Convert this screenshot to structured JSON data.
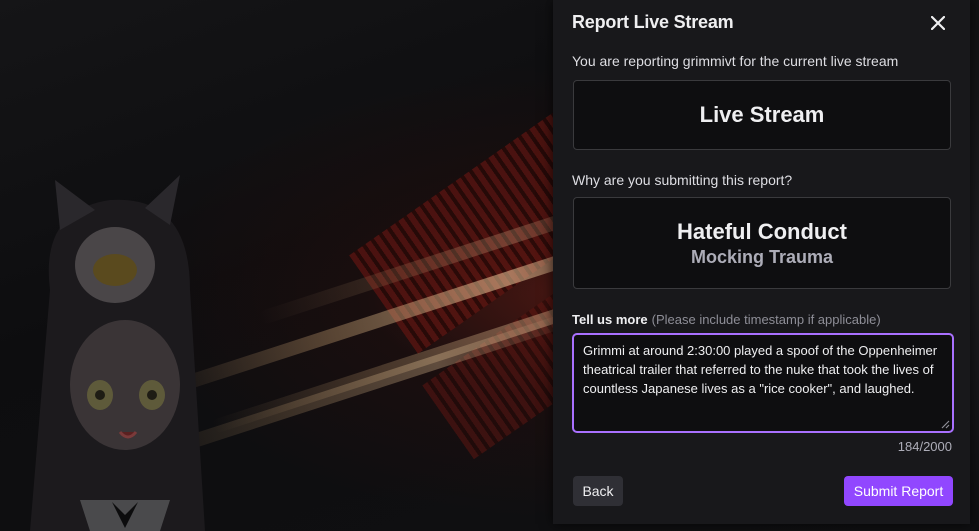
{
  "modal": {
    "title": "Report Live Stream",
    "subtitle": "You are reporting grimmivt for the current live stream",
    "content_type": "Live Stream",
    "question": "Why are you submitting this report?",
    "reason_main": "Hateful Conduct",
    "reason_sub": "Mocking Trauma",
    "tell_label": "Tell us more",
    "tell_hint": "(Please include timestamp if applicable)",
    "details_text": "Grimmi at around 2:30:00 played a spoof of the Oppenheimer theatrical trailer that referred to the nuke that took the lives of countless Japanese lives as a \"rice cooker\", and laughed.",
    "char_count": "184/2000",
    "back_label": "Back",
    "submit_label": "Submit Report"
  },
  "icons": {
    "close": "close-icon",
    "resize": "resize-grip-icon"
  },
  "colors": {
    "accent": "#9147ff",
    "focus_border": "#a970ff",
    "modal_bg": "#18181b"
  }
}
